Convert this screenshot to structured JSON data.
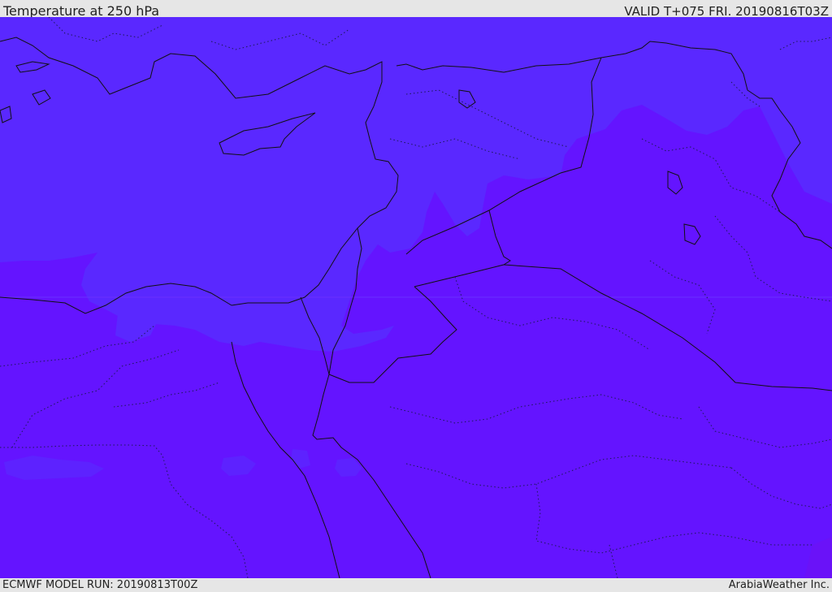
{
  "header": {
    "title": "Temperature at 250 hPa",
    "valid_time": "VALID T+075 FRI. 20190816T03Z"
  },
  "footer": {
    "model_run": "ECMWF MODEL RUN: 20190813T00Z",
    "credit": "ArabiaWeather Inc."
  },
  "colors": {
    "background_bar": "#e6e6e6",
    "field_cold": "#5a28ff",
    "field_warm": "#6414ff",
    "field_warmest": "#6a12f8",
    "country_border": "#111111",
    "province_border": "#1a1a55"
  }
}
